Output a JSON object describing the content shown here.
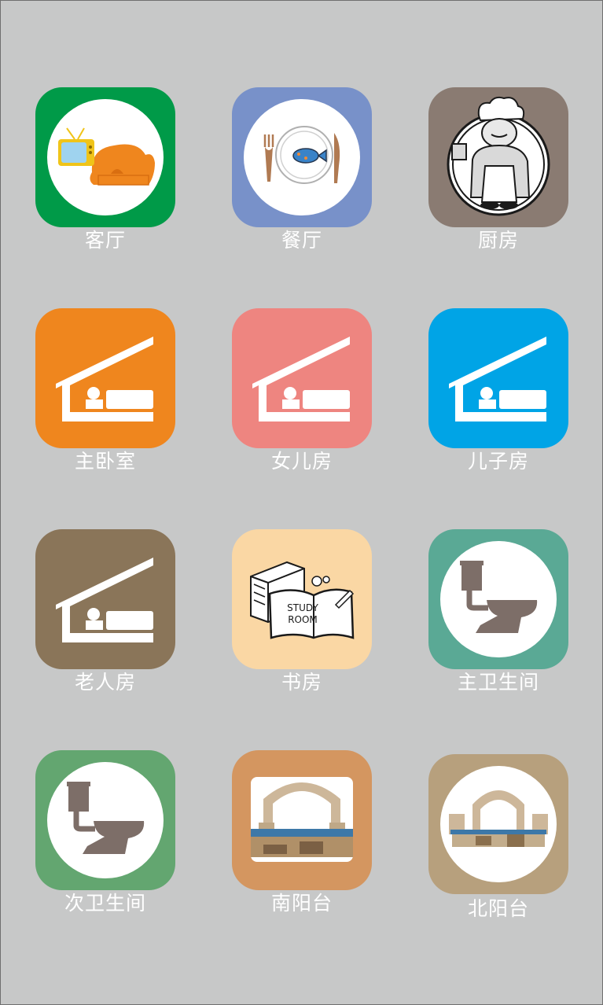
{
  "rooms": [
    {
      "label": "客厅",
      "color": "#009a48",
      "icon": "sofa-tv-icon"
    },
    {
      "label": "餐厅",
      "color": "#7891c9",
      "icon": "plate-cutlery-icon"
    },
    {
      "label": "厨房",
      "color": "#8a7b72",
      "icon": "chef-icon"
    },
    {
      "label": "主卧室",
      "color": "#ef861e",
      "icon": "bedroom-icon"
    },
    {
      "label": "女儿房",
      "color": "#ee8580",
      "icon": "bedroom-icon"
    },
    {
      "label": "儿子房",
      "color": "#00a4e6",
      "icon": "bedroom-icon"
    },
    {
      "label": "老人房",
      "color": "#8a7559",
      "icon": "bedroom-icon"
    },
    {
      "label": "书房",
      "color": "#fad7a4",
      "icon": "study-book-icon",
      "icon_text": "STUDY ROOM"
    },
    {
      "label": "主卫生间",
      "color": "#5aa995",
      "icon": "toilet-icon"
    },
    {
      "label": "次卫生间",
      "color": "#63a670",
      "icon": "toilet-icon"
    },
    {
      "label": "南阳台",
      "color": "#d49660",
      "icon": "balcony-photo-icon"
    },
    {
      "label": "北阳台",
      "color": "#b7a07d",
      "icon": "balcony-photo-icon"
    }
  ]
}
